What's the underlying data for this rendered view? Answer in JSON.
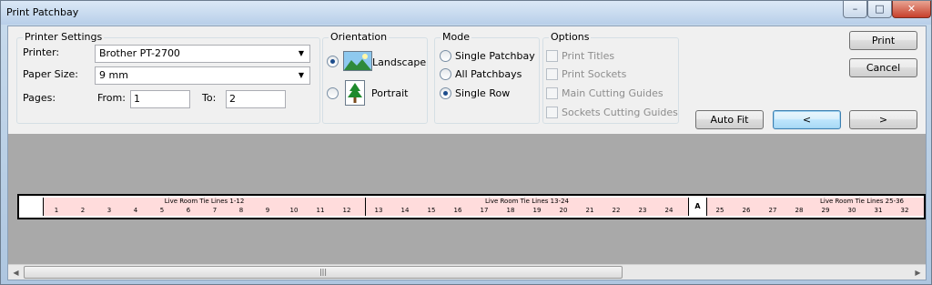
{
  "window": {
    "title": "Print Patchbay",
    "controls": {
      "minimize": "–",
      "maximize": "□",
      "close": "✕"
    }
  },
  "printer_settings": {
    "group_label": "Printer Settings",
    "printer_label": "Printer:",
    "printer_value": "Brother PT-2700",
    "paper_size_label": "Paper Size:",
    "paper_size_value": "9 mm",
    "pages_label": "Pages:",
    "from_label": "From:",
    "from_value": "1",
    "to_label": "To:",
    "to_value": "2"
  },
  "orientation": {
    "group_label": "Orientation",
    "landscape_label": "Landscape",
    "portrait_label": "Portrait",
    "selected": "Landscape"
  },
  "mode": {
    "group_label": "Mode",
    "options": [
      "Single Patchbay",
      "All Patchbays",
      "Single Row"
    ],
    "selected": "Single Row"
  },
  "options": {
    "group_label": "Options",
    "items": [
      "Print Titles",
      "Print Sockets",
      "Main Cutting Guides",
      "Sockets Cutting Guides"
    ]
  },
  "buttons": {
    "print": "Print",
    "cancel": "Cancel",
    "auto_fit": "Auto Fit",
    "prev": "<",
    "next": ">"
  },
  "preview": {
    "marker": "A",
    "sections": [
      {
        "title": "Live Room Tie Lines 1-12",
        "numbers": [
          "1",
          "2",
          "3",
          "4",
          "5",
          "6",
          "7",
          "8",
          "9",
          "10",
          "11",
          "12"
        ]
      },
      {
        "title": "Live Room Tie Lines 13-24",
        "numbers": [
          "13",
          "14",
          "15",
          "16",
          "17",
          "18",
          "19",
          "20",
          "21",
          "22",
          "23",
          "24"
        ]
      },
      {
        "title": "Live Room Tie Lines 25-36",
        "numbers": [
          "25",
          "26",
          "27",
          "28",
          "29",
          "30",
          "31",
          "32"
        ]
      }
    ]
  },
  "scrollbar": {
    "left_arrow": "◀",
    "right_arrow": "▶",
    "grip": "|||"
  },
  "colors": {
    "label_fill": "#ffdcdc",
    "preview_bg": "#a9a9a9",
    "accent": "#3c7fb1"
  }
}
